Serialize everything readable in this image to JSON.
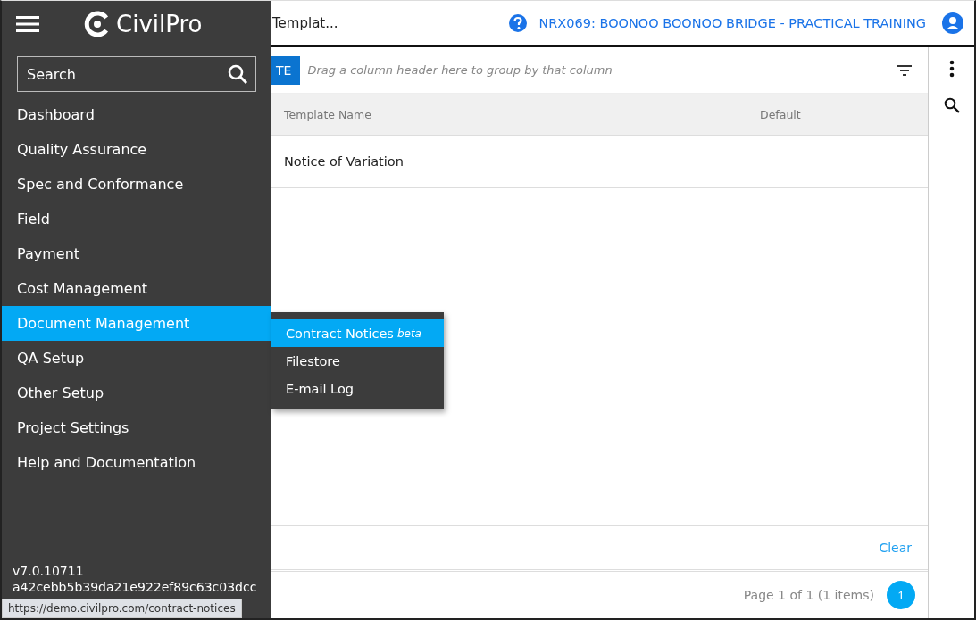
{
  "header": {
    "title": "Templat...",
    "project": "NRX069: BOONOO BOONOO BRIDGE - PRACTICAL TRAINING"
  },
  "sidebar": {
    "logo": "CivilPro",
    "search": {
      "placeholder": "Search"
    },
    "items": [
      {
        "label": "Dashboard",
        "selected": false
      },
      {
        "label": "Quality Assurance",
        "selected": false
      },
      {
        "label": "Spec and Conformance",
        "selected": false
      },
      {
        "label": "Field",
        "selected": false
      },
      {
        "label": "Payment",
        "selected": false
      },
      {
        "label": "Cost Management",
        "selected": false
      },
      {
        "label": "Document Management",
        "selected": true,
        "children": [
          {
            "label": "Contract Notices",
            "badge": "beta",
            "selected": true
          },
          {
            "label": "Filestore",
            "selected": false
          },
          {
            "label": "E-mail Log",
            "selected": false
          }
        ]
      },
      {
        "label": "QA Setup",
        "selected": false
      },
      {
        "label": "Other Setup",
        "selected": false
      },
      {
        "label": "Project Settings",
        "selected": false
      },
      {
        "label": "Help and Documentation",
        "selected": false
      }
    ],
    "version": [
      "v7.0.10711",
      "a42cebb5b39da21e922ef89c63c03dcc"
    ]
  },
  "grid": {
    "button": "TE",
    "group_hint": "Drag a column header here to group by that column",
    "columns": [
      "Template Name",
      "Default"
    ],
    "rows": [
      [
        "Notice of Variation",
        ""
      ]
    ],
    "clear": "Clear",
    "pager_info": "Page 1 of 1 (1 items)",
    "pages": [
      {
        "label": "1",
        "selected": true
      }
    ]
  },
  "status_url": "https://demo.civilpro.com/contract-notices"
}
